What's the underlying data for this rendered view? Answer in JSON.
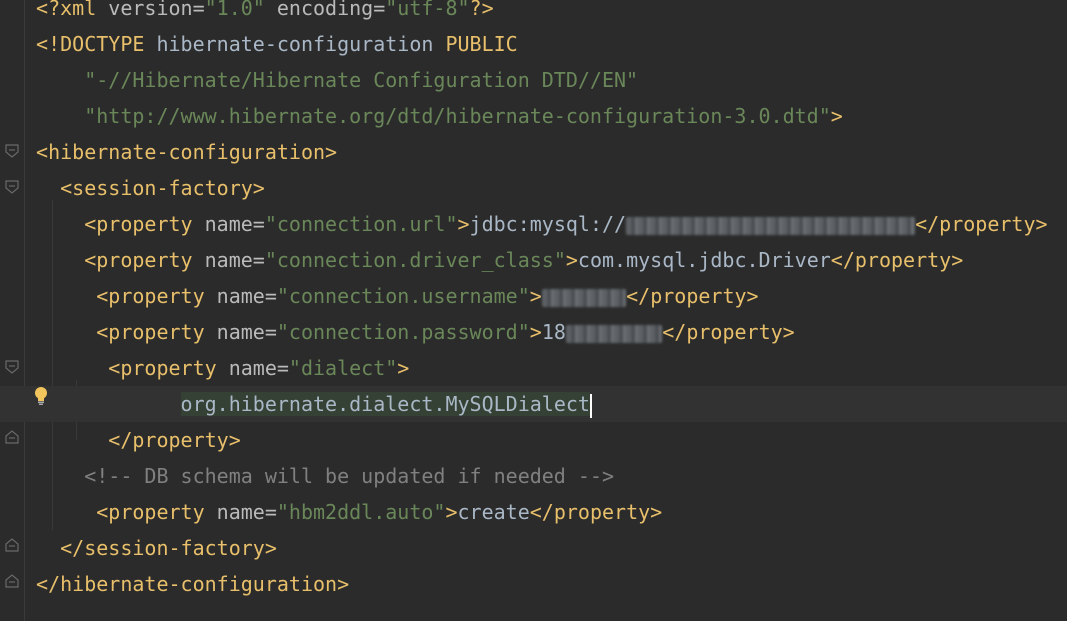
{
  "lines": [
    {
      "parts": [
        {
          "cls": "t-tag",
          "text": "<?xml "
        },
        {
          "cls": "t-attr",
          "text": "version="
        },
        {
          "cls": "t-val",
          "text": "\"1.0\" "
        },
        {
          "cls": "t-attr",
          "text": "encoding="
        },
        {
          "cls": "t-val",
          "text": "\"utf-8\""
        },
        {
          "cls": "t-tag",
          "text": "?>"
        }
      ]
    },
    {
      "parts": [
        {
          "cls": "t-doctype",
          "text": "<!DOCTYPE "
        },
        {
          "cls": "t-text",
          "text": "hibernate-configuration "
        },
        {
          "cls": "t-doctype",
          "text": "PUBLIC"
        }
      ]
    },
    {
      "parts": [
        {
          "cls": "t-val",
          "text": "    \"-//Hibernate/Hibernate Configuration DTD//EN\""
        }
      ]
    },
    {
      "parts": [
        {
          "cls": "t-val",
          "text": "    \"http://www.hibernate.org/dtd/hibernate-configuration-3.0.dtd\""
        },
        {
          "cls": "t-doctype",
          "text": ">"
        }
      ]
    },
    {
      "parts": [
        {
          "cls": "t-tag",
          "text": "<hibernate-configuration>"
        }
      ]
    },
    {
      "parts": [
        {
          "cls": "t-tag",
          "text": "  <session-factory>"
        }
      ]
    },
    {
      "parts": [
        {
          "cls": "t-tag",
          "text": "    <property "
        },
        {
          "cls": "t-attr",
          "text": "name="
        },
        {
          "cls": "t-val",
          "text": "\"connection.url\""
        },
        {
          "cls": "t-tag",
          "text": ">"
        },
        {
          "cls": "t-text",
          "text": "jdbc:mysql://"
        },
        {
          "cls": "blur",
          "text": "localhost:3306/mindolder"
        },
        {
          "cls": "t-tag",
          "text": "</property>"
        }
      ]
    },
    {
      "parts": [
        {
          "cls": "t-tag",
          "text": "    <property "
        },
        {
          "cls": "t-attr",
          "text": "name="
        },
        {
          "cls": "t-val",
          "text": "\"connection.driver_class\""
        },
        {
          "cls": "t-tag",
          "text": ">"
        },
        {
          "cls": "t-text",
          "text": "com.mysql.jdbc.Driver"
        },
        {
          "cls": "t-tag",
          "text": "</property>"
        }
      ]
    },
    {
      "parts": [
        {
          "cls": "t-tag",
          "text": "     <property "
        },
        {
          "cls": "t-attr",
          "text": "name="
        },
        {
          "cls": "t-val",
          "text": "\"connection.username\""
        },
        {
          "cls": "t-tag",
          "text": ">"
        },
        {
          "cls": "blur",
          "text": "nmmroot"
        },
        {
          "cls": "t-tag",
          "text": "</property>"
        }
      ]
    },
    {
      "parts": [
        {
          "cls": "t-tag",
          "text": "     <property "
        },
        {
          "cls": "t-attr",
          "text": "name="
        },
        {
          "cls": "t-val",
          "text": "\"connection.password\""
        },
        {
          "cls": "t-tag",
          "text": ">"
        },
        {
          "cls": "t-text",
          "text": "18"
        },
        {
          "cls": "blur",
          "text": "42013672"
        },
        {
          "cls": "t-tag",
          "text": "</property>"
        }
      ]
    },
    {
      "parts": [
        {
          "cls": "t-tag",
          "text": "      <property "
        },
        {
          "cls": "t-attr",
          "text": "name="
        },
        {
          "cls": "t-val",
          "text": "\"dialect\""
        },
        {
          "cls": "t-tag",
          "text": ">"
        }
      ]
    },
    {
      "parts": [
        {
          "cls": "t-text",
          "text": "            "
        },
        {
          "cls": "sel",
          "text": "org.hibernate.dialect.MySQLDialect"
        }
      ],
      "current": true
    },
    {
      "parts": [
        {
          "cls": "t-tag",
          "text": "      </property>"
        }
      ]
    },
    {
      "parts": [
        {
          "cls": "t-comment",
          "text": "    <!-- DB schema will be updated if needed -->"
        }
      ]
    },
    {
      "parts": [
        {
          "cls": "t-tag",
          "text": "     <property "
        },
        {
          "cls": "t-attr",
          "text": "name="
        },
        {
          "cls": "t-val",
          "text": "\"hbm2ddl.auto\""
        },
        {
          "cls": "t-tag",
          "text": ">"
        },
        {
          "cls": "t-text",
          "text": "create"
        },
        {
          "cls": "t-tag",
          "text": "</property>"
        }
      ]
    },
    {
      "parts": [
        {
          "cls": "t-tag",
          "text": "  </session-factory>"
        }
      ]
    },
    {
      "parts": [
        {
          "cls": "t-tag",
          "text": "</hibernate-configuration>"
        }
      ]
    }
  ],
  "icons": {
    "fold_open": "fold-open-icon",
    "fold_close": "fold-close-icon",
    "intention": "lightbulb-icon"
  },
  "colors": {
    "background": "#2b2b2b",
    "tag": "#e8bf6a",
    "attribute": "#bababa",
    "value": "#6a8759",
    "text": "#a9b7c6",
    "comment": "#808080"
  }
}
